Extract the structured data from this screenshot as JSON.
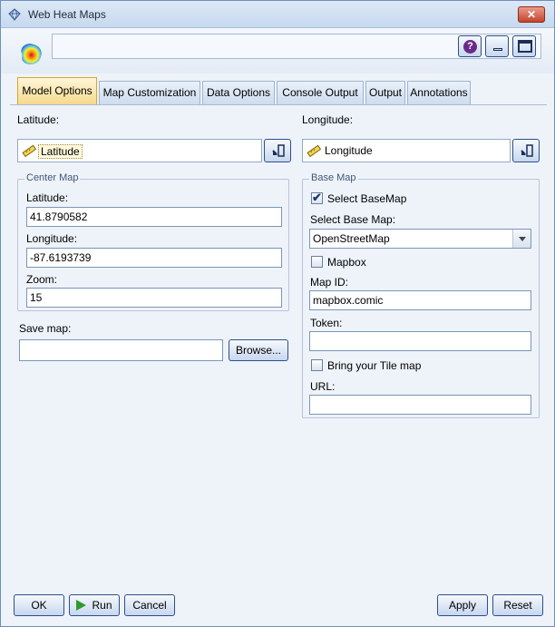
{
  "window": {
    "title": "Web Heat Maps",
    "close_glyph": "✕"
  },
  "header": {
    "help_glyph": "?"
  },
  "tabs": [
    {
      "label": "Model Options"
    },
    {
      "label": "Map Customization"
    },
    {
      "label": "Data Options"
    },
    {
      "label": "Console Output"
    },
    {
      "label": "Output"
    },
    {
      "label": "Annotations"
    }
  ],
  "fields": {
    "latitude_label": "Latitude:",
    "latitude_value": "Latitude",
    "longitude_label": "Longitude:",
    "longitude_value": "Longitude"
  },
  "center_map": {
    "legend": "Center Map",
    "latitude_label": "Latitude:",
    "latitude_value": "41.8790582",
    "longitude_label": "Longitude:",
    "longitude_value": "-87.6193739",
    "zoom_label": "Zoom:",
    "zoom_value": "15"
  },
  "save_map": {
    "label": "Save map:",
    "value": "",
    "browse_label": "Browse..."
  },
  "base_map": {
    "legend": "Base Map",
    "select_basemap_label": "Select BaseMap",
    "select_basemap_checked": true,
    "select_base_map_label": "Select Base Map:",
    "base_map_value": "OpenStreetMap",
    "mapbox_label": "Mapbox",
    "mapbox_checked": false,
    "map_id_label": "Map ID:",
    "map_id_value": "mapbox.comic",
    "token_label": "Token:",
    "token_value": "",
    "bring_tile_label": "Bring your Tile map",
    "bring_tile_checked": false,
    "url_label": "URL:",
    "url_value": ""
  },
  "footer": {
    "ok_label": "OK",
    "run_label": "Run",
    "cancel_label": "Cancel",
    "apply_label": "Apply",
    "reset_label": "Reset"
  },
  "icons": {
    "app_logo": "heatmap-icon",
    "title_icon": "diamond-icon",
    "field_type": "ruler-icon",
    "picker": "field-picker-icon"
  }
}
